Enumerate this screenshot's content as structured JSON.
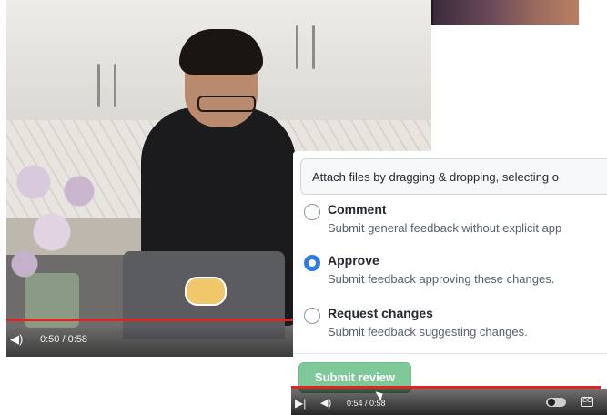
{
  "video1": {
    "time_display": "0:50 / 0:58",
    "progress": 0.86,
    "volume_icon": "volume-icon"
  },
  "panel": {
    "attach_text": "Attach files by dragging & dropping, selecting o",
    "options": [
      {
        "title": "Comment",
        "description": "Submit general feedback without explicit app",
        "checked": false
      },
      {
        "title": "Approve",
        "description": "Submit feedback approving these changes.",
        "checked": true
      },
      {
        "title": "Request changes",
        "description": "Submit feedback suggesting changes.",
        "checked": false
      }
    ],
    "submit_label": "Submit review"
  },
  "video2": {
    "time_display": "0:54 / 0:58",
    "progress": 0.98,
    "icons": [
      "next-icon",
      "volume-icon",
      "autoplay-toggle",
      "cc-icon"
    ]
  },
  "colors": {
    "accent": "#2f7ae5",
    "progress_red": "#e2231f",
    "submit_green": "#7fc89a"
  }
}
